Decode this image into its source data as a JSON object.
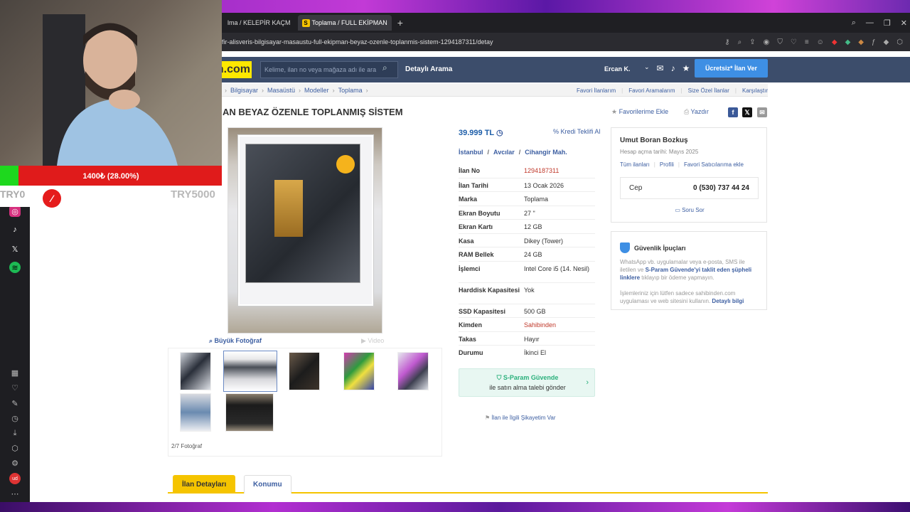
{
  "browser": {
    "tabs": [
      {
        "label": "lma / KELEPİR KAÇM"
      },
      {
        "label": "Toplama / FULL EKİPMAN",
        "favicon": "S"
      }
    ],
    "url": "fir-alisveris-bilgisayar-masaustu-full-ekipman-beyaz-ozenle-toplanmis-sistem-1294187311/detay"
  },
  "stream": {
    "progress_text": "1400₺ (28.00%)",
    "progress_percent": 28,
    "try_left": "TRY0",
    "try_right": "TRY5000"
  },
  "site": {
    "logo": "n.com",
    "search_placeholder": "Kelime, ilan no veya mağaza adı ile ara",
    "detailed_search": "Detaylı Arama",
    "user": "Ercan K.",
    "post_button": "Ücretsiz* İlan Ver"
  },
  "breadcrumb": {
    "items": [
      "Bilgisayar",
      "Masaüstü",
      "Modeller",
      "Toplama"
    ],
    "right": [
      "Favori İlanlarım",
      "Favori Aramalarım",
      "Size Özel İlanlar",
      "Karşılaştır"
    ]
  },
  "listing": {
    "title": "AN BEYAZ ÖZENLE TOPLANMIŞ SİSTEM",
    "favorite": "Favorilerime Ekle",
    "print": "Yazdır",
    "big_photo": "Büyük Fotoğraf",
    "video": "Video",
    "photo_count": "2/7 Fotoğraf",
    "price": "39.999 TL",
    "credit": "Kredi Teklifi Al",
    "location": [
      "İstanbul",
      "Avcılar",
      "Cihangir Mah."
    ],
    "details": [
      {
        "k": "İlan No",
        "v": "1294187311",
        "red": true
      },
      {
        "k": "İlan Tarihi",
        "v": "13 Ocak 2026"
      },
      {
        "k": "Marka",
        "v": "Toplama"
      },
      {
        "k": "Ekran Boyutu",
        "v": "27 \""
      },
      {
        "k": "Ekran Kartı",
        "v": "12 GB"
      },
      {
        "k": "Kasa",
        "v": "Dikey (Tower)"
      },
      {
        "k": "RAM Bellek",
        "v": "24 GB"
      },
      {
        "k": "İşlemci",
        "v": "Intel Core i5 (14. Nesil)"
      },
      {
        "k": "Harddisk Kapasitesi",
        "v": "Yok"
      },
      {
        "k": "SSD Kapasitesi",
        "v": "500 GB"
      },
      {
        "k": "Kimden",
        "v": "Sahibinden",
        "red": true
      },
      {
        "k": "Takas",
        "v": "Hayır"
      },
      {
        "k": "Durumu",
        "v": "İkinci El"
      }
    ],
    "sparam_title": "S-Param Güvende",
    "sparam_sub": "ile satın alma talebi gönder",
    "complaint": "İlan ile İlgili Şikayetim Var"
  },
  "seller": {
    "name": "Umut Boran Bozkuş",
    "since": "Hesap açma tarihi: Mayıs 2025",
    "links": [
      "Tüm ilanları",
      "Profili",
      "Favori Satıcılarıma ekle"
    ],
    "phone_label": "Cep",
    "phone": "0 (530) 737 44 24",
    "ask": "Soru Sor"
  },
  "security": {
    "title": "Güvenlik İpuçları",
    "text1": "WhatsApp vb. uygulamalar veya e-posta, SMS ile iletilen ve",
    "link1": "S-Param Güvende'yi taklit eden şüpheli linklere",
    "text2": "tıklayıp bir ödeme yapmayın.",
    "text3": "İşlemleriniz için lütfen sadece sahibinden.com uygulaması ve web sitesini kullanın.",
    "link2": "Detaylı bilgi"
  },
  "page_tabs": [
    "İlan Detayları",
    "Konumu"
  ],
  "colors": {
    "accent": "#f5c400",
    "header": "#3c4d6b",
    "link": "#3c5ea1",
    "price": "#1c5da8"
  }
}
